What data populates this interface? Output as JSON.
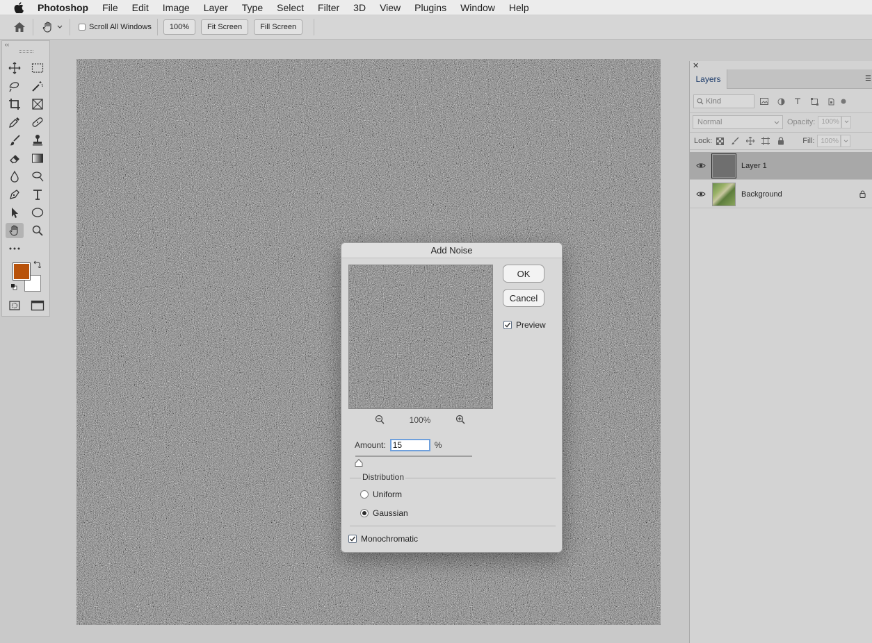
{
  "menubar": {
    "app_name": "Photoshop",
    "items": [
      "File",
      "Edit",
      "Image",
      "Layer",
      "Type",
      "Select",
      "Filter",
      "3D",
      "View",
      "Plugins",
      "Window",
      "Help"
    ]
  },
  "options_bar": {
    "scroll_all_windows": "Scroll All Windows",
    "zoom_100": "100%",
    "fit_screen": "Fit Screen",
    "fill_screen": "Fill Screen"
  },
  "toolbar": {
    "foreground_color": "#b8520a",
    "background_color": "#ffffff"
  },
  "layers_panel": {
    "tab_label": "Layers",
    "filter_kind": "Kind",
    "blend_mode": "Normal",
    "opacity_label": "Opacity:",
    "opacity_value": "100%",
    "lock_label": "Lock:",
    "fill_label": "Fill:",
    "fill_value": "100%",
    "layers": [
      {
        "name": "Layer 1",
        "selected": true
      },
      {
        "name": "Background",
        "selected": false,
        "locked": true
      }
    ]
  },
  "dialog": {
    "title": "Add Noise",
    "ok_label": "OK",
    "cancel_label": "Cancel",
    "preview_label": "Preview",
    "preview_checked": true,
    "zoom_value": "100%",
    "amount_label": "Amount:",
    "amount_value": "15",
    "amount_unit": "%",
    "distribution_label": "Distribution",
    "uniform_label": "Uniform",
    "gaussian_label": "Gaussian",
    "distribution_selected": "Gaussian",
    "monochromatic_label": "Monochromatic",
    "monochromatic_checked": true
  }
}
